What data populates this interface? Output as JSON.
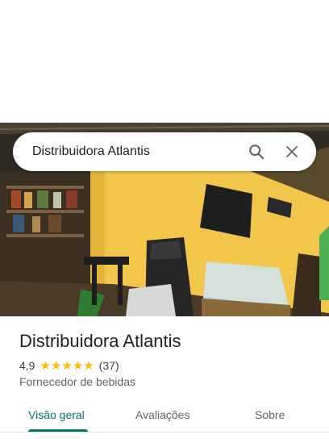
{
  "search": {
    "query": "Distribuidora Atlantis",
    "search_icon": "search-icon",
    "close_icon": "close-icon"
  },
  "place": {
    "name": "Distribuidora Atlantis",
    "rating": "4,9",
    "stars": 5,
    "review_count": "(37)",
    "category": "Fornecedor de bebidas"
  },
  "tabs": [
    {
      "label": "Visão geral",
      "active": true
    },
    {
      "label": "Avaliações",
      "active": false
    },
    {
      "label": "Sobre",
      "active": false
    }
  ],
  "colors": {
    "accent": "#00796b",
    "star": "#fbbc04",
    "wall": "#f2c64a"
  }
}
